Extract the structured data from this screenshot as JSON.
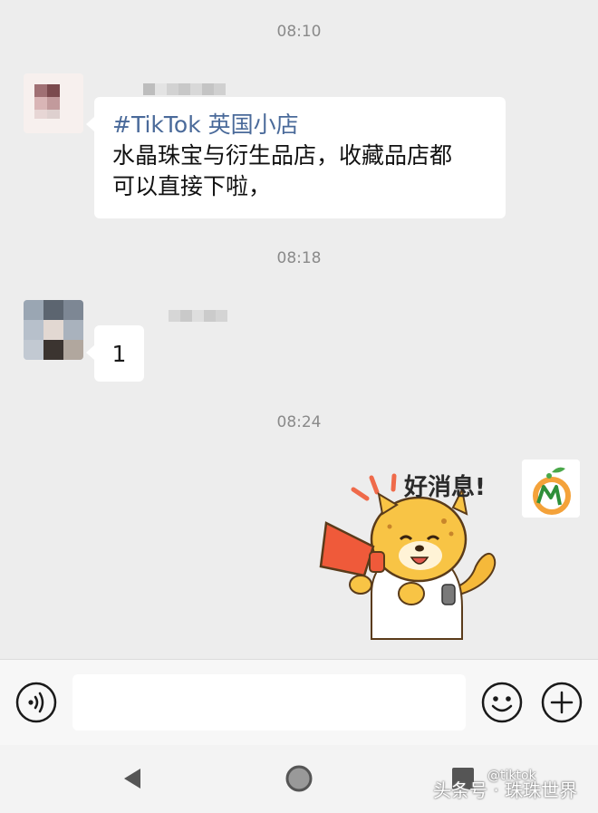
{
  "chat": {
    "messages": [
      {
        "time": "08:10",
        "tag": "#TikTok 英国小店",
        "line1": "水晶珠宝与衍生品店，收藏品店都",
        "line2": "可以直接下啦，"
      },
      {
        "time": "08:18",
        "text": "1"
      },
      {
        "time": "08:24",
        "sticker_text": "好消息!"
      }
    ]
  },
  "composer": {
    "placeholder": ""
  },
  "watermark": {
    "main": "头条号 · 珠珠世界",
    "handle": "@tiktok"
  },
  "colors": {
    "background": "#ededed",
    "bubble": "#ffffff",
    "link": "#4a6a9a",
    "sticker_orange": "#f5a623"
  }
}
